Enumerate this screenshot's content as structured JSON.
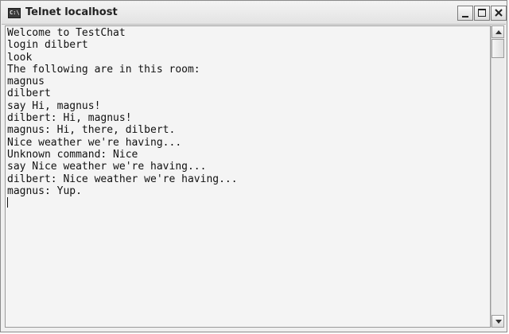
{
  "window": {
    "title": "Telnet localhost",
    "icon": "console-app-icon",
    "icon_glyph": "C:\\",
    "buttons": {
      "minimize": "minimize-icon",
      "maximize": "maximize-icon",
      "close": "close-icon"
    }
  },
  "console": {
    "lines": [
      "Welcome to TestChat",
      "login dilbert",
      "look",
      "The following are in this room:",
      "magnus",
      "dilbert",
      "say Hi, magnus!",
      "dilbert: Hi, magnus!",
      "magnus: Hi, there, dilbert.",
      "Nice weather we're having...",
      "Unknown command: Nice",
      "say Nice weather we're having...",
      "dilbert: Nice weather we're having...",
      "magnus: Yup."
    ]
  },
  "scrollbar": {
    "position": 0
  }
}
